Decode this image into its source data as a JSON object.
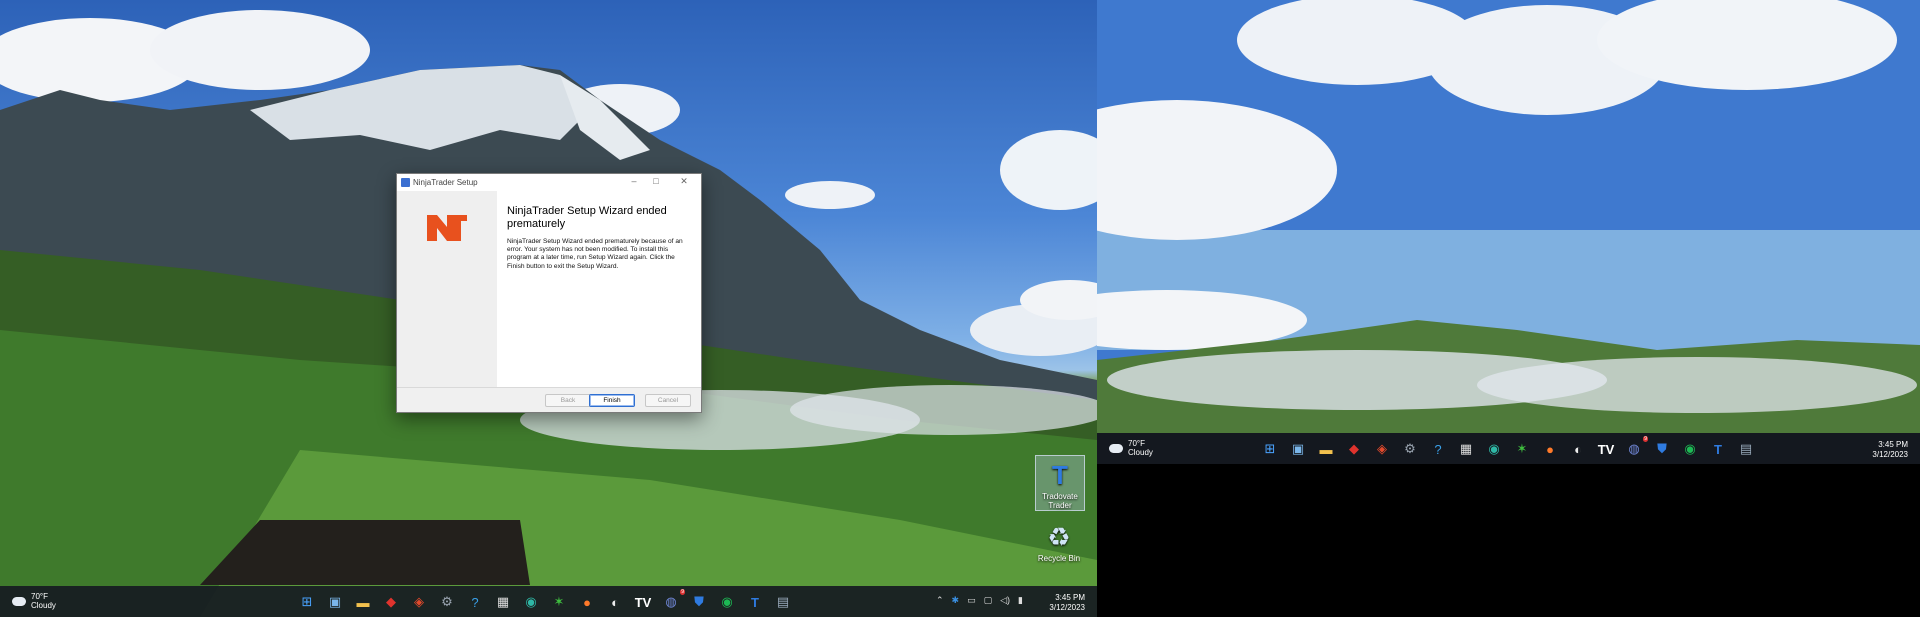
{
  "dialog": {
    "title": "NinjaTrader Setup",
    "heading": "NinjaTrader Setup Wizard ended prematurely",
    "body": "NinjaTrader Setup Wizard ended prematurely because of an error. Your system has not been modified. To install this program at a later time, run Setup Wizard again. Click the Finish button to exit the Setup Wizard.",
    "buttons": {
      "back": "Back",
      "finish": "Finish",
      "cancel": "Cancel"
    },
    "logo_text": "NT",
    "brand_color": "#e8511e"
  },
  "desktop_icons": [
    {
      "label": "Tradovate Trader",
      "icon": "tradovate-icon"
    },
    {
      "label": "Recycle Bin",
      "icon": "recycle-bin-icon"
    }
  ],
  "taskbar_left": {
    "weather": {
      "temp": "70°F",
      "condition": "Cloudy"
    },
    "clock": {
      "time": "3:45 PM",
      "date": "3/12/2023"
    },
    "apps": [
      "start-icon",
      "widgets-icon",
      "file-explorer-icon",
      "diamond-app-icon",
      "diamond-app-2-icon",
      "settings-icon",
      "help-icon",
      "store-icon",
      "edge-icon",
      "green-app-icon",
      "firefox-icon",
      "pill-app-icon",
      "tradingview-icon",
      "discord-icon",
      "defender-icon",
      "spotify-icon",
      "tradovate-icon",
      "control-panel-icon"
    ],
    "discord_badge": "9"
  },
  "taskbar_right": {
    "weather": {
      "temp": "70°F",
      "condition": "Cloudy"
    },
    "clock": {
      "time": "3:45 PM",
      "date": "3/12/2023"
    },
    "discord_badge": "9"
  }
}
